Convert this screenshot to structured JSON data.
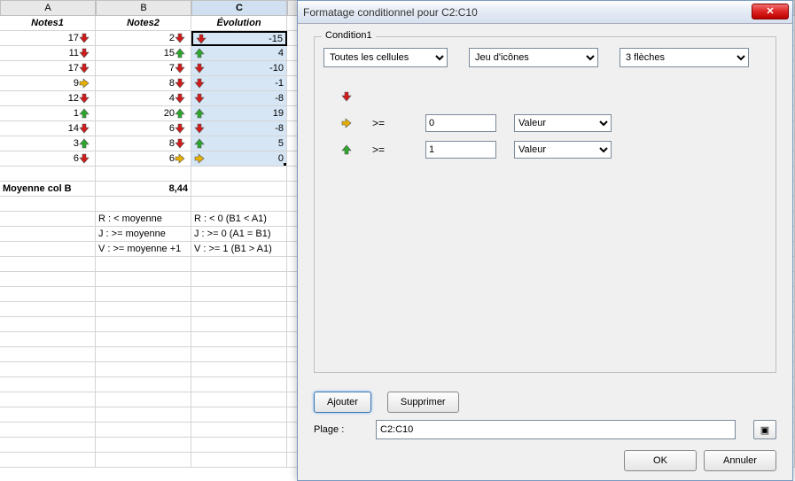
{
  "columns": [
    "A",
    "B",
    "C"
  ],
  "headers": {
    "A": "Notes1",
    "B": "Notes2",
    "C": "Évolution"
  },
  "rows": [
    {
      "A": {
        "v": "17",
        "a": "red"
      },
      "B": {
        "v": "2",
        "a": "red"
      },
      "C": {
        "v": "-15",
        "a": "red"
      }
    },
    {
      "A": {
        "v": "11",
        "a": "red"
      },
      "B": {
        "v": "15",
        "a": "green"
      },
      "C": {
        "v": "4",
        "a": "green"
      }
    },
    {
      "A": {
        "v": "17",
        "a": "red"
      },
      "B": {
        "v": "7",
        "a": "red"
      },
      "C": {
        "v": "-10",
        "a": "red"
      }
    },
    {
      "A": {
        "v": "9",
        "a": "yellow"
      },
      "B": {
        "v": "8",
        "a": "red"
      },
      "C": {
        "v": "-1",
        "a": "red"
      }
    },
    {
      "A": {
        "v": "12",
        "a": "red"
      },
      "B": {
        "v": "4",
        "a": "red"
      },
      "C": {
        "v": "-8",
        "a": "red"
      }
    },
    {
      "A": {
        "v": "1",
        "a": "green"
      },
      "B": {
        "v": "20",
        "a": "green"
      },
      "C": {
        "v": "19",
        "a": "green"
      }
    },
    {
      "A": {
        "v": "14",
        "a": "red"
      },
      "B": {
        "v": "6",
        "a": "red"
      },
      "C": {
        "v": "-8",
        "a": "red"
      }
    },
    {
      "A": {
        "v": "3",
        "a": "green"
      },
      "B": {
        "v": "8",
        "a": "red"
      },
      "C": {
        "v": "5",
        "a": "green"
      }
    },
    {
      "A": {
        "v": "6",
        "a": "red"
      },
      "B": {
        "v": "6",
        "a": "yellow"
      },
      "C": {
        "v": "0",
        "a": "yellow"
      }
    }
  ],
  "summary": {
    "label": "Moyenne col B",
    "value": "8,44"
  },
  "legend": [
    {
      "b": "R : < moyenne",
      "c": "R : < 0  (B1 < A1)"
    },
    {
      "b": "J : >= moyenne",
      "c": "J : >= 0 (A1 = B1)"
    },
    {
      "b": "V : >= moyenne +1",
      "c": "V : >= 1 (B1 > A1)"
    }
  ],
  "dialog": {
    "title": "Formatage conditionnel pour C2:C10",
    "condition_label": "Condition1",
    "scope": "Toutes les cellules",
    "style": "Jeu d'icônes",
    "iconset": "3 flèches",
    "rules": [
      {
        "icon": "red",
        "op": "",
        "value": "",
        "type": ""
      },
      {
        "icon": "yellow",
        "op": ">=",
        "value": "0",
        "type": "Valeur"
      },
      {
        "icon": "green",
        "op": ">=",
        "value": "1",
        "type": "Valeur"
      }
    ],
    "add": "Ajouter",
    "del": "Supprimer",
    "range_label": "Plage :",
    "range": "C2:C10",
    "ok": "OK",
    "cancel": "Annuler"
  }
}
